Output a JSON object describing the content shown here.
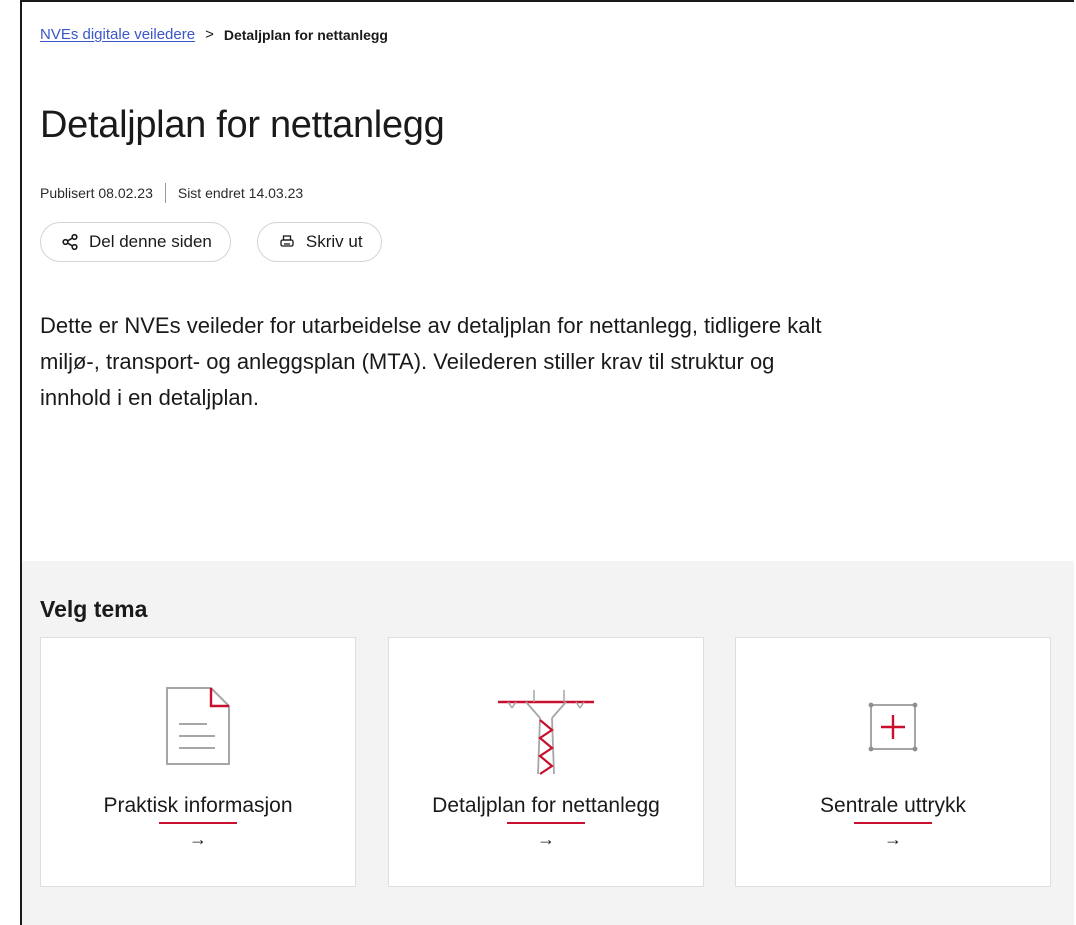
{
  "breadcrumb": {
    "home": "NVEs digitale veiledere",
    "separator": ">",
    "current": "Detaljplan for nettanlegg"
  },
  "page": {
    "title": "Detaljplan for nettanlegg",
    "published": "Publisert 08.02.23",
    "updated": "Sist endret 14.03.23",
    "intro": "Dette er NVEs veileder for utarbeidelse av detaljplan for nettanlegg, tidligere kalt miljø-, transport- og anleggsplan (MTA). Veilederen stiller krav til struktur og innhold i en detaljplan."
  },
  "actions": {
    "share": {
      "label": "Del denne siden",
      "icon": "share-icon"
    },
    "print": {
      "label": "Skriv ut",
      "icon": "print-icon"
    }
  },
  "themes": {
    "heading": "Velg tema",
    "cards": [
      {
        "label": "Praktisk informasjon",
        "icon": "document-icon",
        "arrow": "→"
      },
      {
        "label": "Detaljplan for nettanlegg",
        "icon": "power-pylon-icon",
        "arrow": "→"
      },
      {
        "label": "Sentrale uttrykk",
        "icon": "plus-square-icon",
        "arrow": "→"
      }
    ]
  },
  "colors": {
    "accent": "#c8102e",
    "link": "#3b56c9",
    "section_bg": "#f3f3f3",
    "icon_gray": "#a6a6a6"
  }
}
